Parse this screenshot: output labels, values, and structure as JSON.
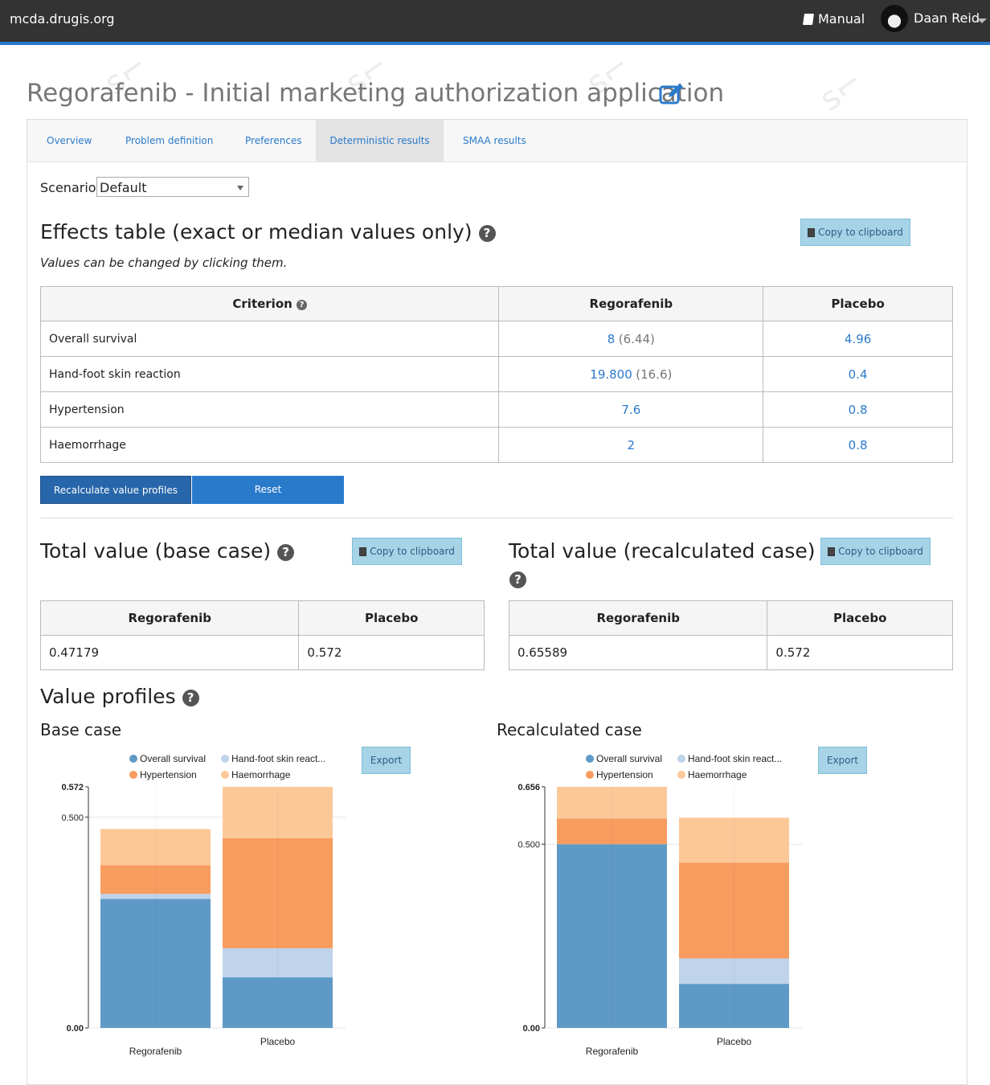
{
  "topbar": {
    "brand": "mcda.drugis.org",
    "manual": "Manual",
    "user": "Daan Reid"
  },
  "page": {
    "title": "Regorafenib - Initial marketing authorization application"
  },
  "tabs": [
    "Overview",
    "Problem definition",
    "Preferences",
    "Deterministic results",
    "SMAA results"
  ],
  "active_tab": "Deterministic results",
  "scenario": {
    "label": "Scenario:",
    "value": "Default"
  },
  "effects": {
    "heading": "Effects table (exact or median values only)",
    "note": "Values can be changed by clicking them.",
    "copy": "Copy to clipboard",
    "headers": {
      "criterion": "Criterion",
      "alt1": "Regorafenib",
      "alt2": "Placebo"
    },
    "rows": [
      {
        "criterion": "Overall survival",
        "alt1": "8",
        "alt1_orig": "(6.44)",
        "alt2": "4.96"
      },
      {
        "criterion": "Hand-foot skin reaction",
        "alt1": "19.800",
        "alt1_orig": "(16.6)",
        "alt2": "0.4"
      },
      {
        "criterion": "Hypertension",
        "alt1": "7.6",
        "alt1_orig": "",
        "alt2": "0.8"
      },
      {
        "criterion": "Haemorrhage",
        "alt1": "2",
        "alt1_orig": "",
        "alt2": "0.8"
      }
    ]
  },
  "buttons": {
    "recalculate": "Recalculate value profiles",
    "reset": "Reset"
  },
  "total_base": {
    "heading": "Total value (base case)",
    "copy": "Copy to clipboard",
    "headers": [
      "Regorafenib",
      "Placebo"
    ],
    "values": [
      "0.47179",
      "0.572"
    ]
  },
  "total_recalc": {
    "heading": "Total value (recalculated case)",
    "copy": "Copy to clipboard",
    "headers": [
      "Regorafenib",
      "Placebo"
    ],
    "values": [
      "0.65589",
      "0.572"
    ]
  },
  "profiles": {
    "heading": "Value profiles",
    "base_title": "Base case",
    "recalc_title": "Recalculated case",
    "export": "Export"
  },
  "colors": {
    "overall": "#5f9ac7",
    "handfoot": "#bfd3ea",
    "hypertension": "#f89c5f",
    "haemorrhage": "#fcc898",
    "link": "#2a7acc"
  },
  "chart_data": [
    {
      "type": "bar",
      "stacked": true,
      "title": "Base case",
      "categories": [
        "Regorafenib",
        "Placebo"
      ],
      "legend": [
        "Overall survival",
        "Hand-foot skin react...",
        "Hypertension",
        "Haemorrhage"
      ],
      "series": [
        {
          "name": "Overall survival",
          "values": [
            0.306,
            0.12
          ]
        },
        {
          "name": "Hand-foot skin reaction",
          "values": [
            0.012,
            0.069
          ]
        },
        {
          "name": "Hypertension",
          "values": [
            0.068,
            0.261
          ]
        },
        {
          "name": "Haemorrhage",
          "values": [
            0.086,
            0.122
          ]
        }
      ],
      "ylim": [
        0,
        0.572
      ],
      "yticks": [
        "0.00",
        "0.500",
        "0.572"
      ]
    },
    {
      "type": "bar",
      "stacked": true,
      "title": "Recalculated case",
      "categories": [
        "Regorafenib",
        "Placebo"
      ],
      "legend": [
        "Overall survival",
        "Hand-foot skin react...",
        "Hypertension",
        "Haemorrhage"
      ],
      "series": [
        {
          "name": "Overall survival",
          "values": [
            0.5,
            0.12
          ]
        },
        {
          "name": "Hand-foot skin reaction",
          "values": [
            0.0,
            0.069
          ]
        },
        {
          "name": "Hypertension",
          "values": [
            0.07,
            0.261
          ]
        },
        {
          "name": "Haemorrhage",
          "values": [
            0.086,
            0.122
          ]
        }
      ],
      "ylim": [
        0,
        0.656
      ],
      "yticks": [
        "0.00",
        "0.500",
        "0.656"
      ]
    }
  ]
}
